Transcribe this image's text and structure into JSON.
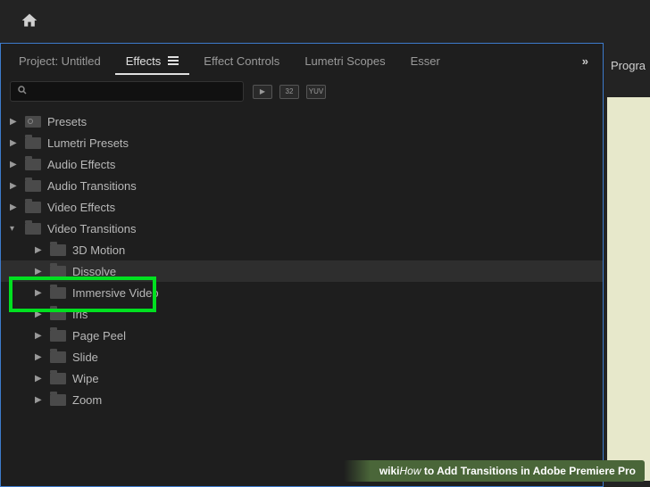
{
  "tabs": {
    "project": "Project: Untitled",
    "effects": "Effects",
    "controls": "Effect Controls",
    "lumetri": "Lumetri Scopes",
    "essential": "Esser",
    "overflow": "»"
  },
  "search": {
    "placeholder": ""
  },
  "toggles": {
    "fx": "▶",
    "n32": "32",
    "yuv": "YUV"
  },
  "tree": {
    "presets": "Presets",
    "lumetri_presets": "Lumetri Presets",
    "audio_effects": "Audio Effects",
    "audio_transitions": "Audio Transitions",
    "video_effects": "Video Effects",
    "video_transitions": "Video Transitions",
    "motion3d": "3D Motion",
    "dissolve": "Dissolve",
    "immersive": "Immersive Video",
    "iris": "Iris",
    "page_peel": "Page Peel",
    "slide": "Slide",
    "wipe": "Wipe",
    "zoom": "Zoom"
  },
  "right": {
    "program": "Progra"
  },
  "watermark": {
    "brand": "wiki",
    "how": "How",
    "title": " to Add Transitions in Adobe Premiere Pro"
  }
}
